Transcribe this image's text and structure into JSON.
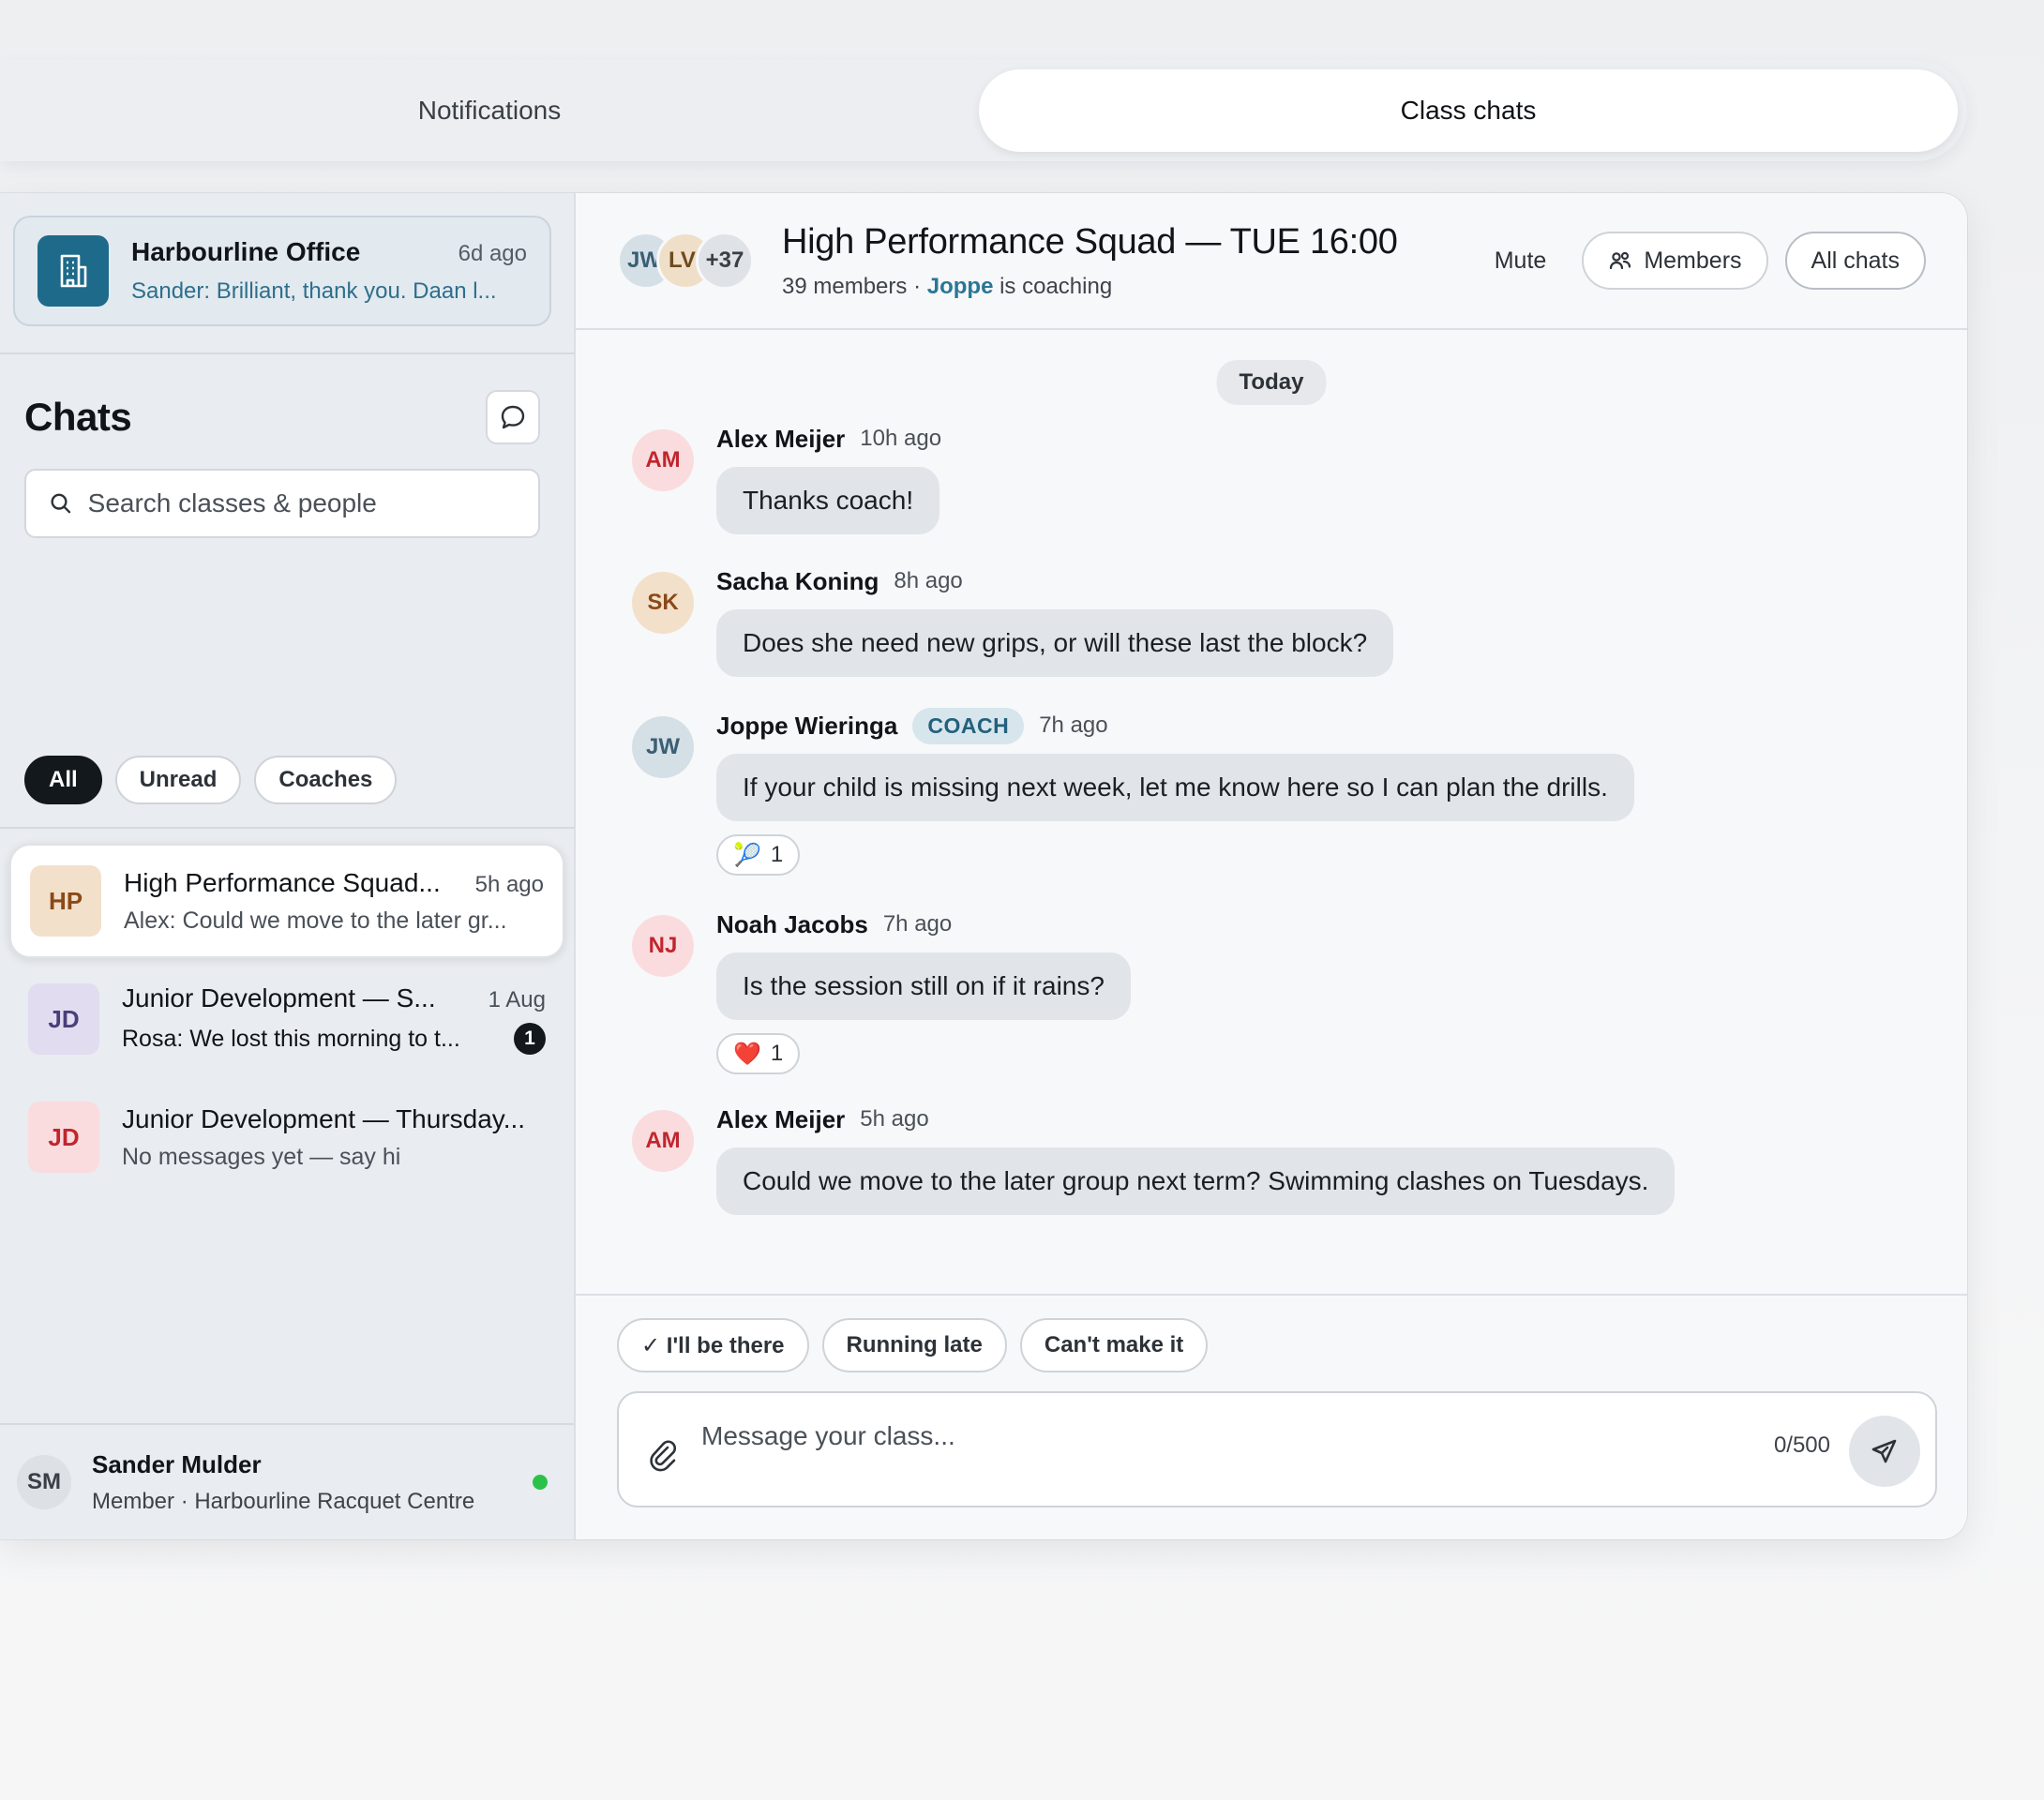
{
  "tabs": [
    {
      "label": "Notifications",
      "active": false
    },
    {
      "label": "Class chats",
      "active": true
    }
  ],
  "office": {
    "name": "Harbourline Office",
    "time": "6d ago",
    "preview": "Sander: Brilliant, thank you. Daan l...",
    "icon": "building-icon"
  },
  "sidebar": {
    "title": "Chats",
    "search_placeholder": "Search classes & people",
    "filters": [
      "All",
      "Unread",
      "Coaches"
    ],
    "active_filter": "All",
    "chats": [
      {
        "initials": "HP",
        "name": "High Performance Squad...",
        "time": "5h ago",
        "preview": "Alex: Could we move to the later gr...",
        "selected": true,
        "unread": "",
        "avatar_bg": "#f3e0cb",
        "avatar_fg": "#8a4a16"
      },
      {
        "initials": "JD",
        "name": "Junior Development — S...",
        "time": "1 Aug",
        "preview": "Rosa: We lost this morning to t...",
        "selected": false,
        "unread": "1",
        "avatar_bg": "#e2dcf0",
        "avatar_fg": "#4a3f7a"
      },
      {
        "initials": "JD",
        "name": "Junior Development — Thursday...",
        "time": "",
        "preview": "No messages yet — say hi",
        "selected": false,
        "unread": "",
        "avatar_bg": "#fadcdf",
        "avatar_fg": "#c0262d"
      }
    ]
  },
  "me": {
    "initials": "SM",
    "name": "Sander Mulder",
    "subtitle": "Member · Harbourline Racquet Centre",
    "status_color": "#2cc24a"
  },
  "conversation": {
    "stack": [
      {
        "initials": "JW",
        "bg": "#d5dfe6",
        "fg": "#3a5f74"
      },
      {
        "initials": "LV",
        "bg": "#f0dfc8",
        "fg": "#6d4a1f"
      },
      {
        "initials": "+37",
        "bg": "#dfe2e6",
        "fg": "#3a3f46"
      }
    ],
    "title": "High Performance Squad — TUE 16:00",
    "members_count": "39 members",
    "separator": "·",
    "coach_name": "Joppe",
    "coach_suffix": "is coaching",
    "mute_label": "Mute",
    "members_label": "Members",
    "all_chats_label": "All chats",
    "day_label": "Today"
  },
  "messages": [
    {
      "initials": "AM",
      "author": "Alex Meijer",
      "time": "10h ago",
      "role": "",
      "text": "Thanks coach!",
      "reaction_emoji": "",
      "reaction_count": "",
      "avatar_bg": "#fadcdf",
      "avatar_fg": "#c0262d"
    },
    {
      "initials": "SK",
      "author": "Sacha Koning",
      "time": "8h ago",
      "role": "",
      "text": "Does she need new grips, or will these last the block?",
      "reaction_emoji": "",
      "reaction_count": "",
      "avatar_bg": "#f3e0cb",
      "avatar_fg": "#8a4a16"
    },
    {
      "initials": "JW",
      "author": "Joppe Wieringa",
      "time": "7h ago",
      "role": "COACH",
      "text": "If your child is missing next week, let me know here so I can plan the drills.",
      "reaction_emoji": "🎾",
      "reaction_count": "1",
      "avatar_bg": "#d5dfe6",
      "avatar_fg": "#3a5f74"
    },
    {
      "initials": "NJ",
      "author": "Noah Jacobs",
      "time": "7h ago",
      "role": "",
      "text": "Is the session still on if it rains?",
      "reaction_emoji": "❤️",
      "reaction_count": "1",
      "avatar_bg": "#fadcdf",
      "avatar_fg": "#c0262d"
    },
    {
      "initials": "AM",
      "author": "Alex Meijer",
      "time": "5h ago",
      "role": "",
      "text": "Could we move to the later group next term? Swimming clashes on Tuesdays.",
      "reaction_emoji": "",
      "reaction_count": "",
      "avatar_bg": "#fadcdf",
      "avatar_fg": "#c0262d"
    }
  ],
  "quick_replies": [
    "✓ I'll be there",
    "Running late",
    "Can't make it"
  ],
  "composer": {
    "placeholder": "Message your class...",
    "counter": "0/500"
  }
}
